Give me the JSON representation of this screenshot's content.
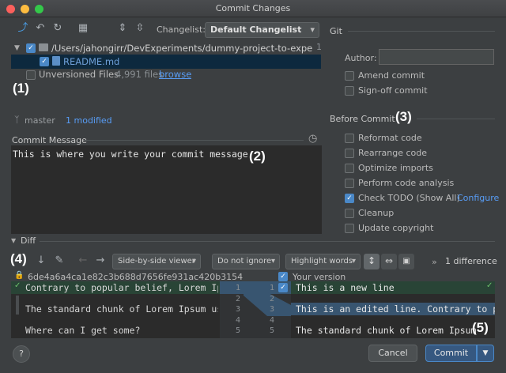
{
  "window": {
    "title": "Commit Changes"
  },
  "toolbar": {
    "changelist_label": "Changelist:",
    "changelist_value": "Default Changelist"
  },
  "git": {
    "section_title": "Git",
    "author_label": "Author:",
    "author_value": "",
    "amend_label": "Amend commit",
    "signoff_label": "Sign-off commit"
  },
  "tree": {
    "root_path": "/Users/jahongirr/DevExperiments/dummy-project-to-experiment",
    "root_count": "1",
    "file_name": "README.md",
    "unversioned_label": "Unversioned Files",
    "unversioned_count": "4,991 files",
    "browse_link": "browse"
  },
  "branch": {
    "name": "master",
    "changes": "1 modified"
  },
  "message": {
    "label": "Commit Message",
    "text": "This is where you write your commit message"
  },
  "before_commit": {
    "title": "Before Commit",
    "options": [
      {
        "label": "Reformat code",
        "checked": false
      },
      {
        "label": "Rearrange code",
        "checked": false
      },
      {
        "label": "Optimize imports",
        "checked": false
      },
      {
        "label": "Perform code analysis",
        "checked": false
      },
      {
        "label": "Check TODO (Show All)",
        "checked": true,
        "link": "Configure"
      },
      {
        "label": "Cleanup",
        "checked": false
      },
      {
        "label": "Update copyright",
        "checked": false
      }
    ]
  },
  "diff": {
    "title": "Diff",
    "viewer": "Side-by-side viewer",
    "ignore": "Do not ignore",
    "highlight": "Highlight words",
    "difference_count": "1 difference",
    "hash": "6de4a6a4ca1e82c3b688d7656fe931ac420b3154",
    "your_version": "Your version",
    "left_lines": [
      "Contrary to popular belief, Lorem Ip",
      "",
      "The standard chunk of Lorem Ipsum us",
      "",
      "Where can I get some?"
    ],
    "right_lines": [
      "This is a new line",
      "",
      "This is an edited line. Contrary to po",
      "",
      "The standard chunk of Lorem Ipsum"
    ],
    "left_numbers": [
      "1",
      "2",
      "3",
      "4",
      "5"
    ],
    "right_numbers": [
      "1",
      "2",
      "3",
      "4",
      "5"
    ]
  },
  "buttons": {
    "help": "?",
    "cancel": "Cancel",
    "commit": "Commit"
  },
  "annotations": {
    "a1": "(1)",
    "a2": "(2)",
    "a3": "(3)",
    "a4": "(4)",
    "a5": "(5)"
  },
  "colors": {
    "accent": "#4a88c7",
    "link": "#589df6",
    "added_bg": "#294436",
    "changed_bg": "#385570",
    "window_bg": "#3c3f41",
    "editor_bg": "#2b2b2b"
  }
}
